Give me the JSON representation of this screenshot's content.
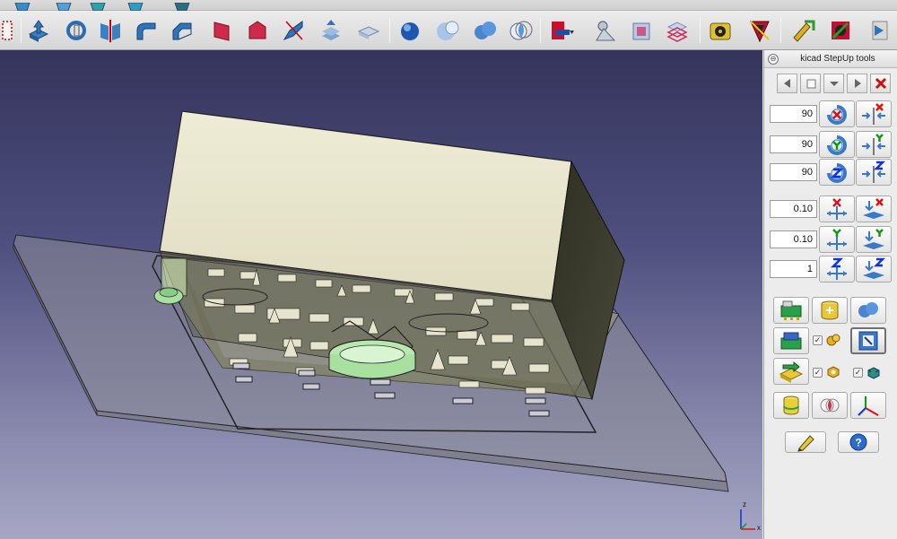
{
  "panel": {
    "title": "kicad StepUp tools",
    "rotate": [
      {
        "axis": "X",
        "value": "90"
      },
      {
        "axis": "Y",
        "value": "90"
      },
      {
        "axis": "Z",
        "value": "90"
      }
    ],
    "translate": [
      {
        "axis": "X",
        "value": "0.10"
      },
      {
        "axis": "Y",
        "value": "0.10"
      },
      {
        "axis": "Z",
        "value": "1"
      }
    ]
  },
  "triad": {
    "z_label": "z",
    "x_label": "x"
  },
  "colors": {
    "viewport_top": "#34345c",
    "viewport_bottom": "#a6a6c4",
    "axis_x": "#dd1111",
    "axis_y": "#119911",
    "axis_z": "#1133dd",
    "board": "#8a8a8a",
    "housing": "#e8e6cf"
  }
}
